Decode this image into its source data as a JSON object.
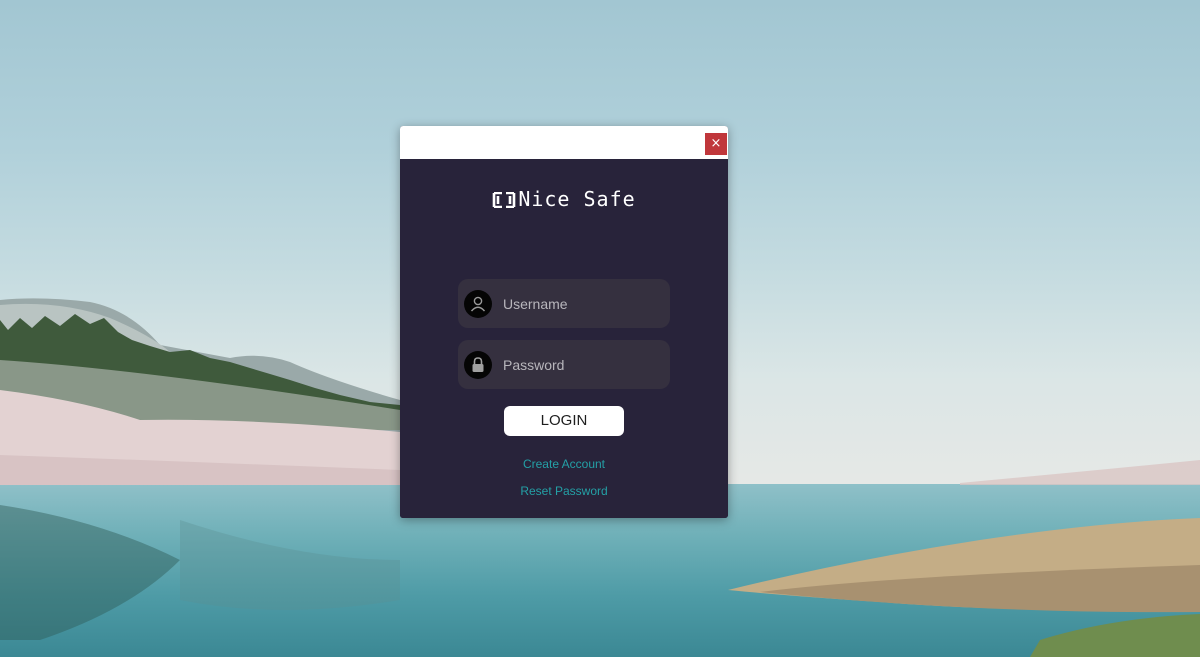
{
  "window": {
    "close_label": "×"
  },
  "app": {
    "title": "Nice Safe",
    "logo_icon": "bracket-logo-icon"
  },
  "form": {
    "username_placeholder": "Username",
    "password_placeholder": "Password",
    "username_icon": "user-icon",
    "password_icon": "lock-icon",
    "login_label": "LOGIN",
    "create_account_label": "Create Account",
    "reset_password_label": "Reset Password"
  },
  "colors": {
    "window_bg": "#28233a",
    "field_bg": "#35303f",
    "link": "#24a0a6",
    "close_button": "#c0373b"
  }
}
